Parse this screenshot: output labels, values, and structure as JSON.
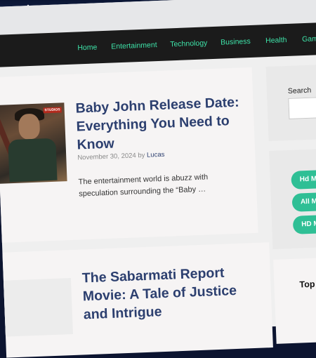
{
  "nav": {
    "items": [
      "Home",
      "Entertainment",
      "Technology",
      "Business",
      "Health",
      "Games"
    ]
  },
  "posts": [
    {
      "title": "Baby John Release Date: Everything You Need to Know",
      "date": "November 30, 2024",
      "by": "by",
      "author": "Lucas",
      "excerpt": "The entertainment world is abuzz with speculation surrounding the “Baby …",
      "thumb_badge": "STUDIOS"
    },
    {
      "title": "The Sabarmati Report Movie: A Tale of Justice and Intrigue"
    }
  ],
  "sidebar": {
    "search_label": "Search",
    "tags": [
      "Hd Mo",
      "All Mo",
      "HD Mo"
    ],
    "top_picks_heading": "Top pi"
  },
  "colors": {
    "nav_bg": "#1b1b1b",
    "nav_link": "#3ee2a8",
    "title": "#2c3f6f",
    "pill": "#2fbf95"
  }
}
